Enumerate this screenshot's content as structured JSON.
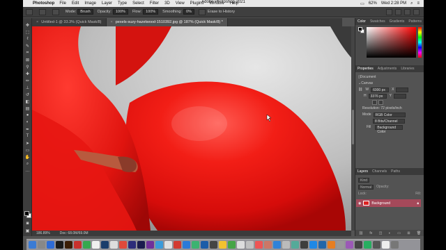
{
  "menubar": {
    "app_name": "Photoshop",
    "items": [
      "File",
      "Edit",
      "Image",
      "Layer",
      "Type",
      "Select",
      "Filter",
      "3D",
      "View",
      "Plugins",
      "Window",
      "Help"
    ],
    "battery": "62%",
    "clock": "Wed 2:28 PM"
  },
  "window_title": "Adobe Photoshop 2021",
  "options": {
    "mode_label": "Mode:",
    "mode_value": "Brush",
    "opacity_label": "Opacity:",
    "opacity_value": "100%",
    "flow_label": "Flow:",
    "flow_value": "100%",
    "smoothing_label": "Smoothing:",
    "smoothing_value": "0%",
    "erase_label": "Erase to History"
  },
  "tabs": [
    {
      "label": "Untitled-1 @ 33.3% (Quick Mask/8)",
      "active": false
    },
    {
      "label": "pexels-suzy-hazelwood-1510392.jpg @ 187% (Quick Mask/8) *",
      "active": true
    }
  ],
  "status": {
    "zoom": "186.89%",
    "doc": "Doc: 68.0M/69.0M"
  },
  "color_panel": {
    "tabs": [
      "Color",
      "Swatches",
      "Gradients",
      "Patterns"
    ],
    "active_tab": "Color",
    "fg_color": "#000000",
    "bg_color": "#ffffff"
  },
  "properties_panel": {
    "tabs": [
      "Properties",
      "Adjustments",
      "Libraries"
    ],
    "active_tab": "Properties",
    "document_label": "Document",
    "canvas_label": "Canvas",
    "w_label": "W",
    "w_value": "6000 px",
    "x_label": "X",
    "h_label": "H",
    "h_value": "3376 px",
    "y_label": "Y",
    "resolution": "Resolution: 72 pixels/inch",
    "mode_label": "Mode",
    "mode_value": "RGB Color",
    "bits_value": "8 Bits/Channel",
    "fill_label": "Fill",
    "fill_value": "Background Color"
  },
  "layers_panel": {
    "tabs": [
      "Layers",
      "Channels",
      "Paths"
    ],
    "active_tab": "Layers",
    "search_placeholder": "Kind",
    "blend_mode": "Normal",
    "opacity_label": "Opacity:",
    "lock_label": "Lock:",
    "fill_label": "Fill:",
    "layer_name": "Background",
    "layer_color": "#a5495a"
  },
  "accent": "#a5495a"
}
